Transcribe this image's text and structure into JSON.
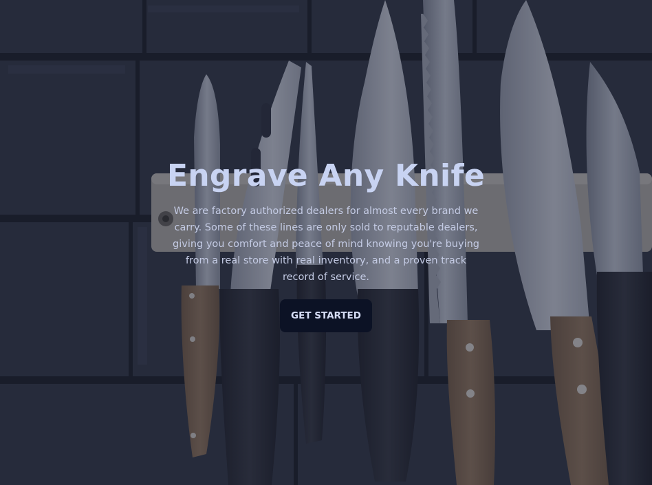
{
  "hero": {
    "title": "Engrave Any Knife",
    "description": "We are factory authorized dealers for almost every brand we carry. Some of these lines are only sold to reputable dealers, giving you comfort and peace of mind knowing you're buying from a real store with real inventory, and a proven track record of service.",
    "cta_label": "GET STARTED",
    "overlay_color": "#1a1e34",
    "title_color": "#c8d3f2",
    "button_color": "#0c1225"
  }
}
